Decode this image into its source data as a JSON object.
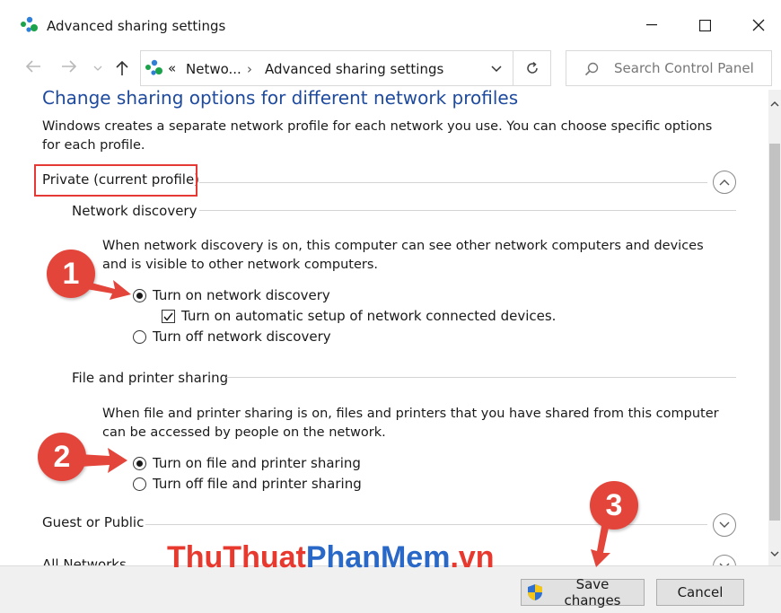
{
  "window": {
    "title": "Advanced sharing settings",
    "controls": {
      "minimize": "minimize",
      "maximize": "maximize",
      "close": "close"
    }
  },
  "navbar": {
    "back_icon": "back-arrow-icon",
    "forward_icon": "forward-arrow-icon",
    "recent_icon": "chevron-down-icon",
    "up_icon": "up-arrow-icon",
    "breadcrumb_overflow": "«",
    "breadcrumb": [
      "Netwo...",
      "Advanced sharing settings"
    ],
    "separator": "›",
    "search_placeholder": "Search Control Panel"
  },
  "main": {
    "heading": "Change sharing options for different network profiles",
    "intro": "Windows creates a separate network profile for each network you use. You can choose specific options for each profile.",
    "sections": [
      {
        "title": "Private (current profile)",
        "expanded": true,
        "subsections": [
          {
            "title": "Network discovery",
            "description": "When network discovery is on, this computer can see other network computers and devices and is visible to other network computers.",
            "options": [
              {
                "label": "Turn on network discovery",
                "type": "radio",
                "checked": true
              },
              {
                "label": "Turn on automatic setup of network connected devices.",
                "type": "checkbox",
                "checked": true
              },
              {
                "label": "Turn off network discovery",
                "type": "radio",
                "checked": false
              }
            ]
          },
          {
            "title": "File and printer sharing",
            "description": "When file and printer sharing is on, files and printers that you have shared from this computer can be accessed by people on the network.",
            "options": [
              {
                "label": "Turn on file and printer sharing",
                "type": "radio",
                "checked": true
              },
              {
                "label": "Turn off file and printer sharing",
                "type": "radio",
                "checked": false
              }
            ]
          }
        ]
      },
      {
        "title": "Guest or Public",
        "expanded": false
      },
      {
        "title": "All Networks",
        "expanded": false
      }
    ]
  },
  "footer": {
    "save_label": "Save changes",
    "cancel_label": "Cancel"
  },
  "annotations": {
    "step1": "1",
    "step2": "2",
    "step3": "3",
    "highlight_color": "#e53935",
    "badge_color": "#e4453a"
  },
  "watermark": {
    "part1": "ThuThuat",
    "part2": "PhanMem",
    "part3": ".vn",
    "color1": "#e8392f",
    "color2": "#2a68c8"
  },
  "colors": {
    "heading": "#1e4a9e",
    "accent": "#e53935"
  }
}
